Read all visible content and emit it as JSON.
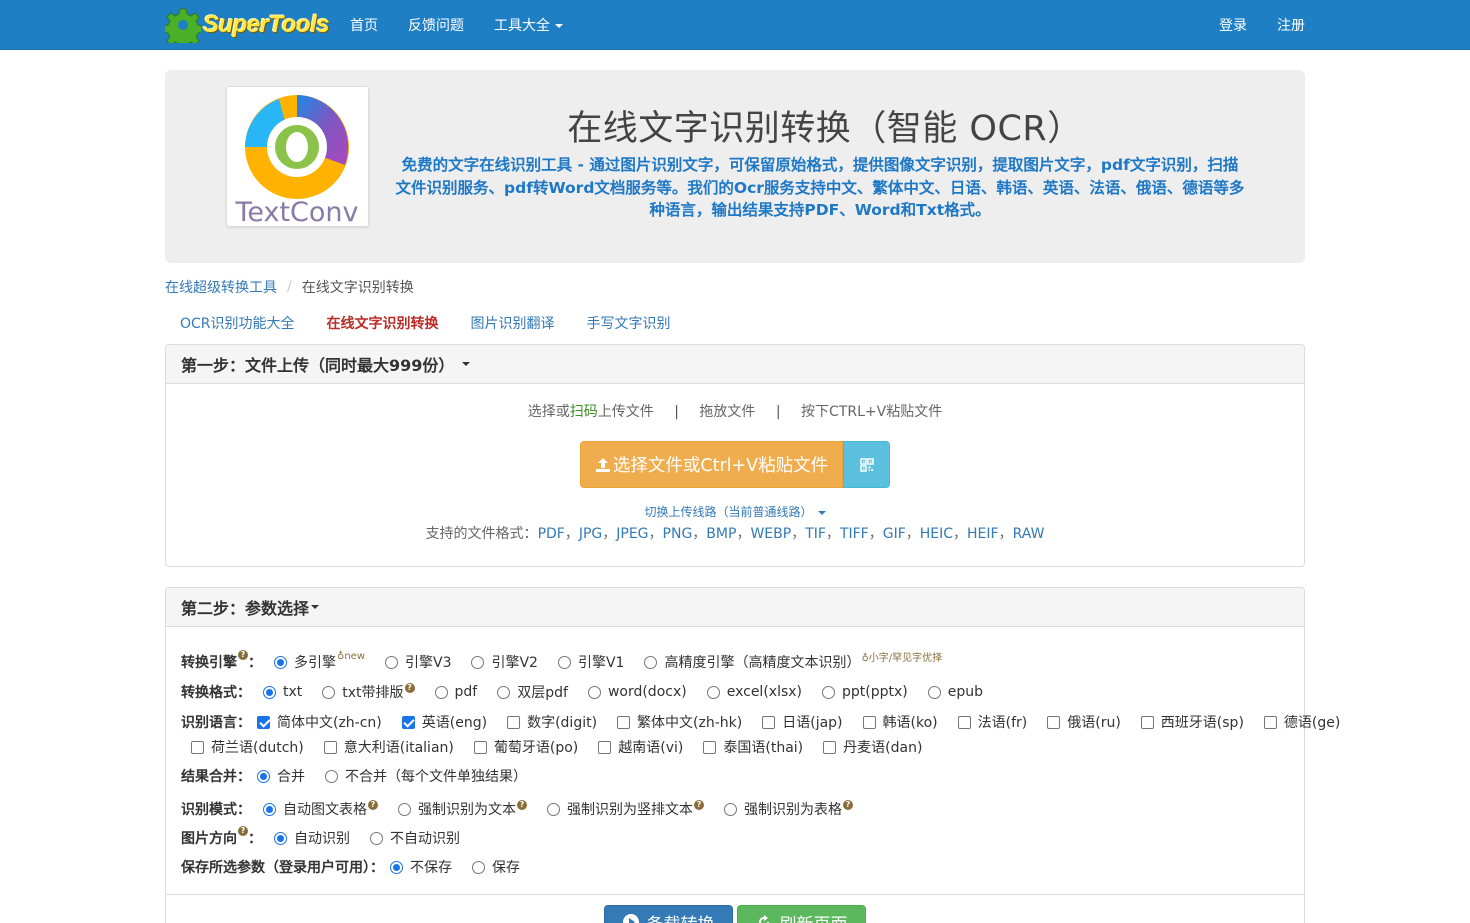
{
  "nav": {
    "logo_text": "SuperTools",
    "links": [
      "首页",
      "反馈问题",
      "工具大全"
    ],
    "login": "登录",
    "register": "注册"
  },
  "jumbo": {
    "logo_caption": "TextConv",
    "title": "在线文字识别转换（智能 OCR）",
    "description": "免费的文字在线识别工具 - 通过图片识别文字，可保留原始格式，提供图像文字识别，提取图片文字，pdf文字识别，扫描文件识别服务、pdf转Word文档服务等。我们的Ocr服务支持中文、繁体中文、日语、韩语、英语、法语、俄语、德语等多种语言，输出结果支持PDF、Word和Txt格式。"
  },
  "breadcrumb": {
    "home": "在线超级转换工具",
    "current": "在线文字识别转换"
  },
  "tabs": [
    "OCR识别功能大全",
    "在线文字识别转换",
    "图片识别翻译",
    "手写文字识别"
  ],
  "step1": {
    "title": "第一步：文件上传（同时最大999份）",
    "way_select_prefix": "选择或",
    "way_scan": "扫码",
    "way_select_suffix": "上传文件",
    "way_drag": "拖放文件",
    "way_paste": "按下CTRL+V粘贴文件",
    "upload_button": "选择文件或Ctrl+V粘贴文件",
    "switch_line": "切换上传线路（当前普通线路）",
    "formats_label": "支持的文件格式：",
    "formats": [
      "PDF",
      "JPG",
      "JPEG",
      "PNG",
      "BMP",
      "WEBP",
      "TIF",
      "TIFF",
      "GIF",
      "HEIC",
      "HEIF",
      "RAW"
    ]
  },
  "step2": {
    "title": "第二步：参数选择",
    "engine_label": "转换引擎",
    "engine_options": [
      "多引擎",
      "引擎V3",
      "引擎V2",
      "引擎V1",
      "高精度引擎（高精度文本识别）"
    ],
    "engine_new": "new",
    "engine_hint": "小字/罕见字优择",
    "format_label": "转换格式：",
    "format_options": [
      "txt",
      "txt带排版",
      "pdf",
      "双层pdf",
      "word(docx)",
      "excel(xlsx)",
      "ppt(pptx)",
      "epub"
    ],
    "lang_label": "识别语言：",
    "lang_options": [
      "简体中文(zh-cn)",
      "英语(eng)",
      "数字(digit)",
      "繁体中文(zh-hk)",
      "日语(jap)",
      "韩语(ko)",
      "法语(fr)",
      "俄语(ru)",
      "西班牙语(sp)",
      "德语(ge)",
      "荷兰语(dutch)",
      "意大利语(italian)",
      "葡萄牙语(po)",
      "越南语(vi)",
      "泰国语(thai)",
      "丹麦语(dan)"
    ],
    "merge_label": "结果合并：",
    "merge_options": [
      "合并",
      "不合并（每个文件单独结果）"
    ],
    "mode_label": "识别模式：",
    "mode_options": [
      "自动图文表格",
      "强制识别为文本",
      "强制识别为竖排文本",
      "强制识别为表格"
    ],
    "orient_label": "图片方向",
    "orient_options": [
      "自动识别",
      "不自动识别"
    ],
    "save_label": "保存所选参数（登录用户可用）：",
    "save_options": [
      "不保存",
      "保存"
    ]
  },
  "buttons": {
    "convert": "备载转换",
    "refresh": "刷新页面"
  },
  "colors": {
    "nav_bg": "#1e7fc4",
    "upload_btn": "#f0ad4e",
    "qr_btn": "#5bc0de",
    "primary": "#337ab7",
    "success": "#5cb85c",
    "desc_text": "#1f78c6",
    "active_tab": "#b92c28"
  }
}
